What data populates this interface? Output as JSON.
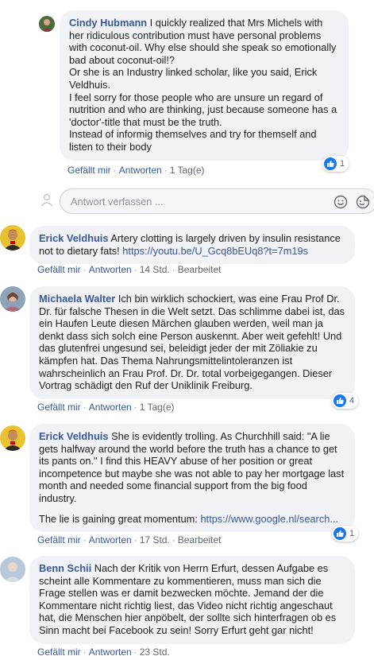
{
  "comments": [
    {
      "author": "Cindy Hubmann",
      "lines": [
        "I quickly realized that Mrs Michels with",
        "her ridiculous contribution must have personal problems",
        "with coconut-oil. Why else should she speak so emotionally",
        "bad about coconut-oil!?",
        "Or she is an Industry linked scholar, like you said, Erick",
        "Veldhuis.",
        "I feel sorry for those people who are unsure un regard of",
        "nutrition and who are thinking, just because someone has a",
        "'doctor'-title that must be the truth.",
        "Instead of informig themselves and try for themself and",
        "listen to their body"
      ],
      "like_label": "Gefällt mir",
      "reply_label": "Antworten",
      "time": "1 Tag(e)",
      "reactions": "1"
    },
    {
      "author": "Erick Veldhuis",
      "lines": [
        "Artery clotting is largely driven by insulin resistance",
        "not to dietary fats!"
      ],
      "link": "https://youtu.be/U_Gcq8bEUq8?t=7m19s",
      "like_label": "Gefällt mir",
      "reply_label": "Antworten",
      "time": "14 Std.",
      "edited": "Bearbeitet"
    },
    {
      "author": "Michaela Walter",
      "lines": [
        "Ich bin wirklich schockiert, was eine Frau Prof Dr.",
        "Dr. für falsche Thesen in die Welt setzt. Das schlimme dabei ist, das",
        "ein Haufen Leute diesen Märchen glauben werden, weil man ja",
        "denkt dass sich solch eine Person auskennt. Aber weit gefehlt! Und",
        "das glutenfrei ungesund sei, beleidigt jeder der mit Zöliakie zu",
        "kämpfen hat. Das Thema Nahrungsmittelintoleranzen ist",
        "wahrscheinlich an Frau Prof. Dr. Dr. total vorbeigegangen. Dieser",
        "Vortrag schädigt den Ruf der Uniklinik Freiburg."
      ],
      "like_label": "Gefällt mir",
      "reply_label": "Antworten",
      "time": "1 Tag(e)",
      "reactions": "4"
    },
    {
      "author": "Erick Veldhuis",
      "lines": [
        "She is evidently trolling. As Churchhill said: \"A lie",
        "gets halfway around the world before the truth has a chance to get",
        "its pants on.\" I find this HEAVY abuse of her position or great",
        "incompetence but maybe she was not able to pay her mortgage last",
        "month and needed some financial support from the big food",
        "industry."
      ],
      "extra_text": "The lie is gaining great momentum:",
      "link": "https://www.google.nl/search...",
      "like_label": "Gefällt mir",
      "reply_label": "Antworten",
      "time": "17 Std.",
      "edited": "Bearbeitet",
      "reactions": "1"
    },
    {
      "author": "Benn Schii",
      "lines": [
        "Nach der Kritik von Herrn Erfurt, dessen Aufgabe es",
        "scheint alle Kommentare zu kommentieren, muss man sich die",
        "Frage stellen was er damit bezwecken möchte. Jemand der die",
        "Kommentare nicht richtig liest, das Video nicht richtig angeschaut",
        "hat, die Menschen hier anpöbelt, der sollte sich hinterfragen ob es",
        "Sinn macht bei Facebook zu sein! Sorry Erfurt geht gar nicht!"
      ],
      "like_label": "Gefällt mir",
      "reply_label": "Antworten",
      "time": "23 Std."
    }
  ],
  "reply_box": {
    "placeholder": "Antwort verfassen ..."
  },
  "icons": {
    "like": "thumbs-up-icon",
    "emoji": "smiley-icon",
    "sticker": "sticker-icon",
    "composer_avatar": "user-avatar-icon"
  },
  "colors": {
    "author": "#385898",
    "like_badge": "#1877f2",
    "bubble": "#f0f2f5"
  }
}
